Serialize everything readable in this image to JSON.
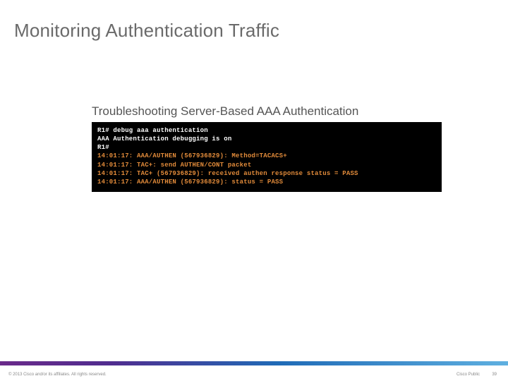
{
  "title": "Monitoring Authentication Traffic",
  "subtitle": {
    "thin": "Troubleshooting ",
    "rest": "Server-Based AAA Authentication"
  },
  "terminal": {
    "lines": [
      {
        "cls": "white",
        "text": "R1# debug aaa authentication"
      },
      {
        "cls": "white",
        "text": "AAA Authentication debugging is on"
      },
      {
        "cls": "white",
        "text": "R1#"
      },
      {
        "cls": "orange",
        "text": "14:01:17: AAA/AUTHEN (567936829): Method=TACACS+"
      },
      {
        "cls": "orange",
        "text": "14:01:17: TAC+: send AUTHEN/CONT packet"
      },
      {
        "cls": "orange",
        "text": "14:01:17: TAC+ (567936829): received authen response status = PASS"
      },
      {
        "cls": "orange",
        "text": "14:01:17: AAA/AUTHEN (567936829): status = PASS"
      }
    ]
  },
  "footer": {
    "copyright": "© 2013 Cisco and/or its affiliates. All rights reserved.",
    "public": "Cisco Public",
    "page": "39"
  }
}
